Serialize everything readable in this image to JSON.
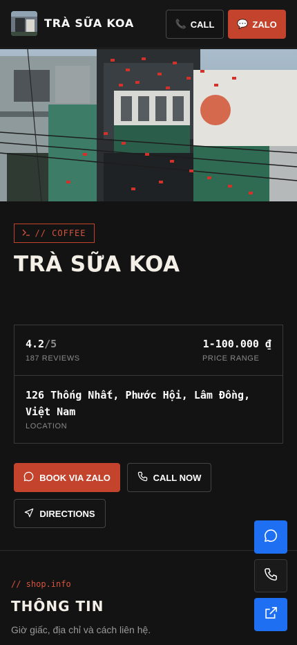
{
  "header": {
    "brand": "TRÀ SỮA KOA",
    "call_label": "CALL",
    "zalo_label": "ZALO",
    "call_icon": "phone-emoji",
    "zalo_icon": "speech-bubble-emoji"
  },
  "hero": {
    "image_alt": "Storefront photo"
  },
  "main": {
    "tag": "// COFFEE",
    "title": "TRÀ SỮA KOA",
    "rating_value": "4.2",
    "rating_out_of": "/5",
    "reviews": "187 REVIEWS",
    "price": "1-100.000 ₫",
    "price_label": "PRICE RANGE",
    "address": "126 Thống Nhất, Phước Hội, Lâm Đồng, Việt Nam",
    "location_label": "LOCATION"
  },
  "actions": {
    "book_zalo": "BOOK VIA ZALO",
    "call_now": "CALL NOW",
    "directions": "DIRECTIONS"
  },
  "section": {
    "tag": "// shop.info",
    "title": "THÔNG TIN",
    "description": "Giờ giấc, địa chỉ và cách liên hệ."
  },
  "colors": {
    "accent": "#c4432d",
    "fab_blue": "#1f6ff2",
    "background": "#131313"
  }
}
